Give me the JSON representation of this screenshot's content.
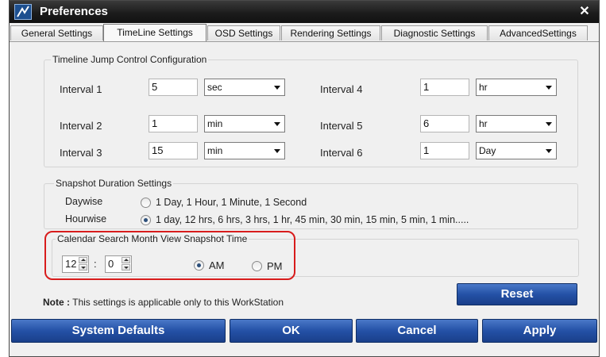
{
  "window": {
    "title": "Preferences"
  },
  "tabs": [
    {
      "label": "General Settings"
    },
    {
      "label": "TimeLine Settings",
      "active": true
    },
    {
      "label": "OSD Settings"
    },
    {
      "label": "Rendering Settings"
    },
    {
      "label": "Diagnostic Settings"
    },
    {
      "label": "AdvancedSettings"
    }
  ],
  "jump_control": {
    "legend": "Timeline Jump Control Configuration",
    "intervals": [
      {
        "label": "Interval 1",
        "value": "5",
        "unit": "sec"
      },
      {
        "label": "Interval 2",
        "value": "1",
        "unit": "min"
      },
      {
        "label": "Interval 3",
        "value": "15",
        "unit": "min"
      },
      {
        "label": "Interval 4",
        "value": "1",
        "unit": "hr"
      },
      {
        "label": "Interval 5",
        "value": "6",
        "unit": "hr"
      },
      {
        "label": "Interval 6",
        "value": "1",
        "unit": "Day"
      }
    ]
  },
  "snapshot_duration": {
    "legend": "Snapshot Duration Settings",
    "daywise_label": "Daywise",
    "daywise_option": "1 Day, 1 Hour, 1 Minute, 1 Second",
    "hourwise_label": "Hourwise",
    "hourwise_option": "1 day, 12 hrs, 6 hrs, 3 hrs, 1 hr, 45 min, 30 min, 15 min, 5 min, 1 min.....",
    "selected": "hourwise"
  },
  "calendar_search": {
    "legend": "Calendar Search Month View Snapshot Time",
    "hour": "12",
    "separator": ":",
    "minute": "0",
    "am_label": "AM",
    "pm_label": "PM",
    "selected": "AM"
  },
  "reset_label": "Reset",
  "note": {
    "prefix": "Note :",
    "text": " This settings is applicable only to this WorkStation"
  },
  "footer": {
    "system_defaults": "System Defaults",
    "ok": "OK",
    "cancel": "Cancel",
    "apply": "Apply"
  },
  "icons": {
    "app": "app-logo-icon",
    "close": "close-icon"
  },
  "colors": {
    "titlebar": "#1c1c1c",
    "button_blue": "#2451a6",
    "highlight_red": "#d81c1c"
  }
}
